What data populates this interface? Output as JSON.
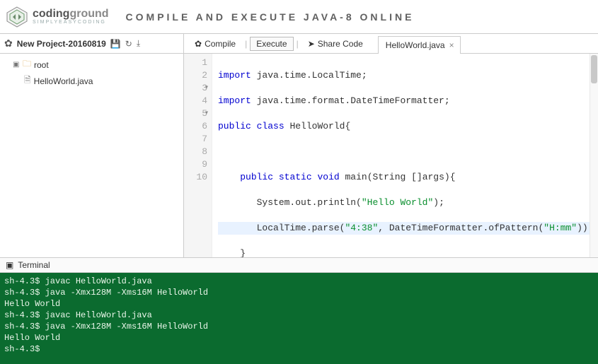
{
  "header": {
    "logo_top_a": "coding",
    "logo_top_b": "ground",
    "logo_sub": "SIMPLYEASYCODING",
    "tagline": "COMPILE AND EXECUTE JAVA-8 ONLINE"
  },
  "left_toolbar": {
    "project_name": "New Project-20160819"
  },
  "right_toolbar": {
    "compile": "Compile",
    "execute": "Execute",
    "share": "Share Code",
    "tab_label": "HelloWorld.java",
    "tab_close": "×"
  },
  "sidebar": {
    "root": "root",
    "file": "HelloWorld.java"
  },
  "gutter": [
    "1",
    "2",
    "3",
    "4",
    "5",
    "6",
    "7",
    "8",
    "9",
    "10"
  ],
  "code": {
    "l1a": "import",
    "l1b": " java.time.LocalTime;",
    "l2a": "import",
    "l2b": " java.time.format.DateTimeFormatter;",
    "l3a": "public",
    "l3b": " ",
    "l3c": "class",
    "l3d": " HelloWorld{",
    "l4": "",
    "l5a": "    ",
    "l5b": "public",
    "l5c": " ",
    "l5d": "static",
    "l5e": " ",
    "l5f": "void",
    "l5g": " main(String []args){",
    "l6a": "       System.out.println(",
    "l6b": "\"Hello World\"",
    "l6c": ");",
    "l7a": "       LocalTime.parse(",
    "l7b": "\"4:38\"",
    "l7c": ", DateTimeFormatter.ofPattern(",
    "l7d": "\"H:mm\"",
    "l7e": "));",
    "l8": "    }",
    "l9": "}"
  },
  "terminal_header": "Terminal",
  "terminal": "sh-4.3$ javac HelloWorld.java\nsh-4.3$ java -Xmx128M -Xms16M HelloWorld\nHello World\nsh-4.3$ javac HelloWorld.java\nsh-4.3$ java -Xmx128M -Xms16M HelloWorld\nHello World\nsh-4.3$"
}
